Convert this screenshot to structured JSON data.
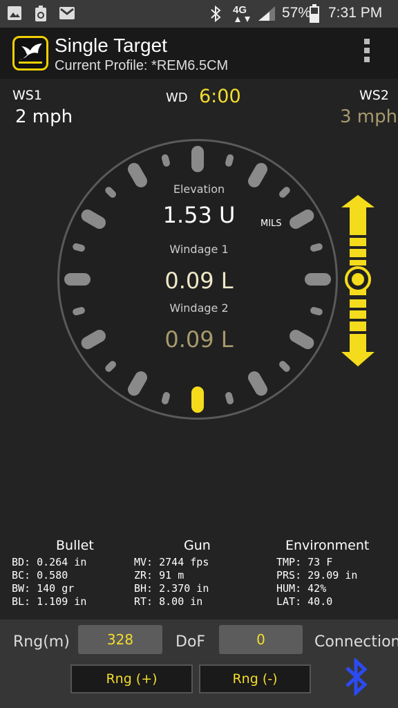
{
  "status_bar": {
    "network": "4G",
    "battery": "57%",
    "time": "7:31 PM",
    "icons": [
      "image-icon",
      "recycle-icon",
      "gmail-icon",
      "bluetooth-icon",
      "network-icon",
      "signal-icon",
      "battery-icon"
    ]
  },
  "app_bar": {
    "title": "Single Target",
    "subtitle": "Current Profile: *REM6.5CM",
    "menu_icon": "overflow-menu-icon"
  },
  "wind": {
    "ws1_label": "WS1",
    "ws1_value": "2 mph",
    "wd_label": "WD",
    "wd_value": "6:00",
    "ws2_label": "WS2",
    "ws2_value": "3 mph"
  },
  "dial": {
    "elevation_label": "Elevation",
    "elevation_value": "1.53 U",
    "units": "MILS",
    "windage1_label": "Windage 1",
    "windage1_value": "0.09 L",
    "windage2_label": "Windage 2",
    "windage2_value": "0.09 L"
  },
  "bullet": {
    "title": "Bullet",
    "lines": [
      "BD: 0.264 in",
      "BC: 0.580",
      "BW: 140 gr",
      "BL: 1.109 in"
    ]
  },
  "gun": {
    "title": "Gun",
    "lines": [
      "MV: 2744 fps",
      "ZR: 91 m",
      "BH: 2.370 in",
      "RT: 8.00 in"
    ]
  },
  "environment": {
    "title": "Environment",
    "lines": [
      "TMP: 73 F",
      "PRS: 29.09 in",
      "HUM: 42%",
      "LAT: 40.0"
    ]
  },
  "controls": {
    "range_label": "Rng(m)",
    "range_value": "328",
    "dof_label": "DoF",
    "dof_value": "0",
    "connection_label": "Connection",
    "rng_plus": "Rng (+)",
    "rng_minus": "Rng (-)"
  },
  "colors": {
    "accent_yellow": "#f4de2c",
    "muted_gold": "#a79a6c",
    "bluetooth_blue": "#2b4bf0"
  }
}
